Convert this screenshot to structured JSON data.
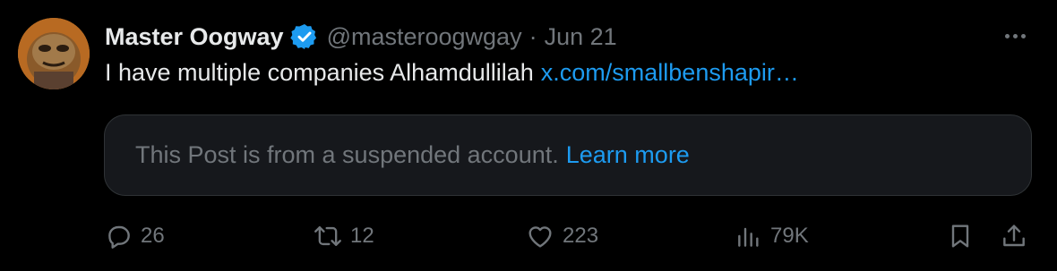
{
  "post": {
    "author": {
      "display_name": "Master Oogway",
      "handle": "@masteroogwgay",
      "verified": true,
      "avatar_icon": "turtle-avatar"
    },
    "separator": "·",
    "date": "Jun 21",
    "text": "I have multiple companies Alhamdullilah",
    "link_text": "x.com/smallbenshapir…",
    "more_icon": "more-horizontal-icon",
    "suspended_card": {
      "message": "This Post is from a suspended account.",
      "learn_more": "Learn more"
    },
    "actions": {
      "replies": "26",
      "reposts": "12",
      "likes": "223",
      "views": "79K"
    }
  },
  "colors": {
    "background": "#000000",
    "primary_text": "#e7e9ea",
    "secondary_text": "#71767b",
    "accent": "#1d9bf0",
    "card_background": "#16181c",
    "card_border": "#2f3336"
  }
}
